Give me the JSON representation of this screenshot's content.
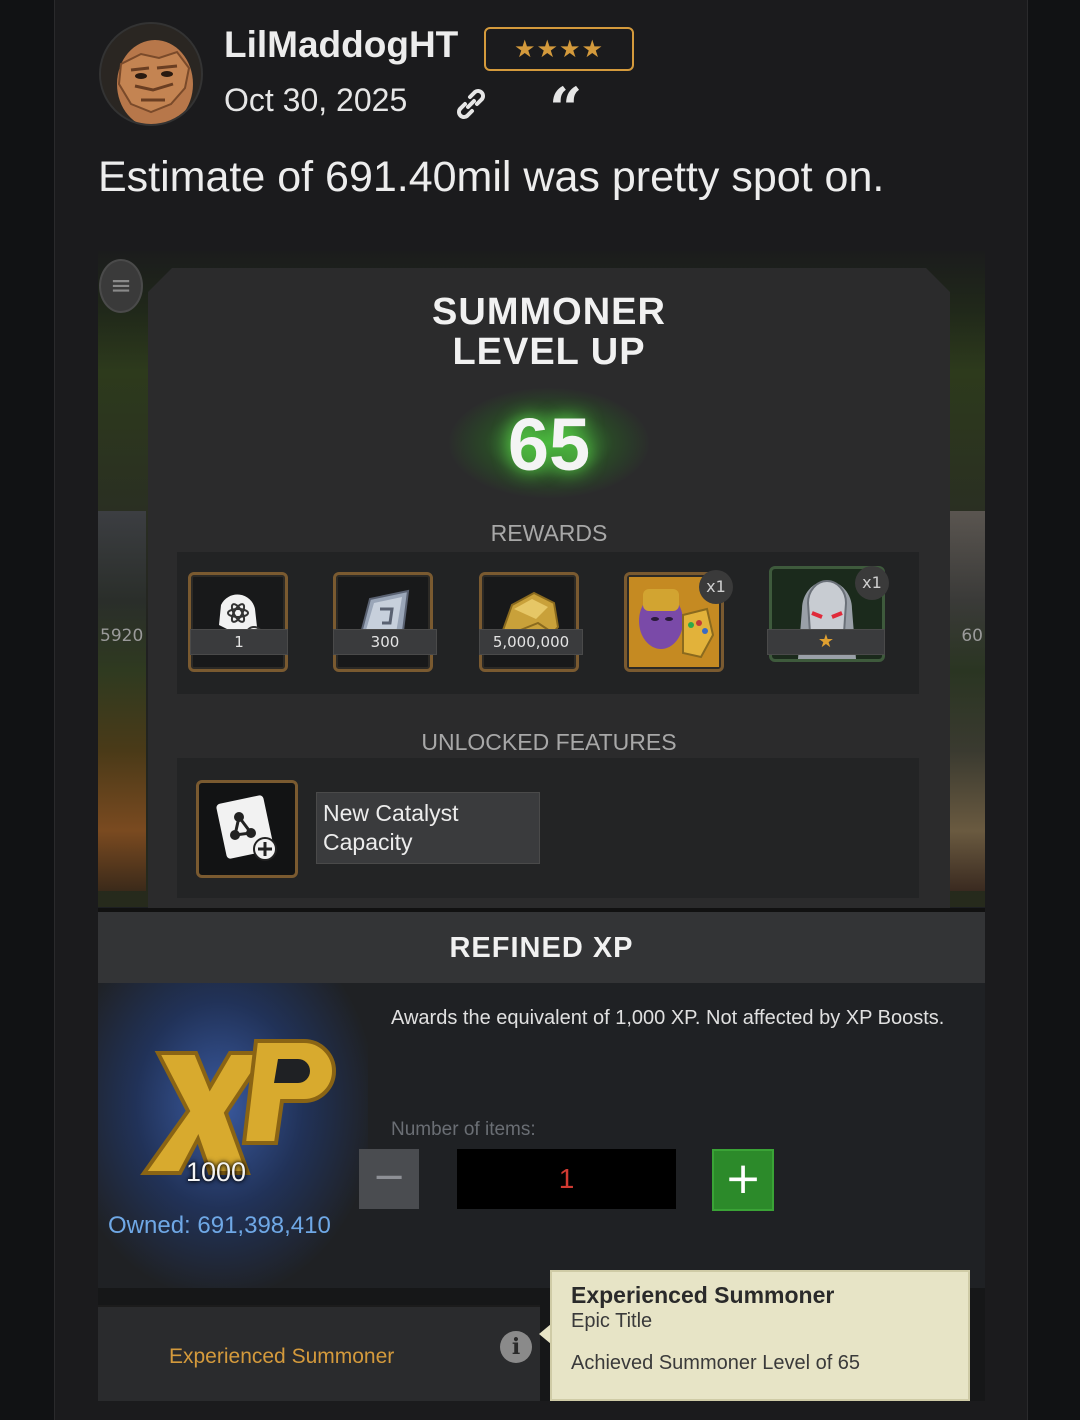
{
  "post": {
    "username": "LilMaddogHT",
    "rank_badge": "★★★★",
    "date": "Oct 30, 2025",
    "body": "Estimate of 691.40mil was pretty spot on."
  },
  "game": {
    "left_side_numbers": "5920",
    "right_side_numbers": "60",
    "level_up": {
      "title_line1": "SUMMONER",
      "title_line2": "LEVEL UP",
      "level": "65",
      "rewards_label": "REWARDS",
      "rewards": [
        {
          "icon": "catalyst-head-icon",
          "qty": "1"
        },
        {
          "icon": "tile-shard-icon",
          "qty": "300"
        },
        {
          "icon": "gold-nugget-icon",
          "qty": "5,000,000"
        },
        {
          "icon": "thanos-avatar-icon",
          "badge": "x1"
        },
        {
          "icon": "ultron-portrait-icon",
          "badge": "x1",
          "qty": "★"
        }
      ],
      "features_label": "UNLOCKED FEATURES",
      "feature": "New Catalyst Capacity"
    },
    "refined_xp": {
      "title": "REFINED XP",
      "description": "Awards the equivalent of 1,000 XP. Not affected by XP Boosts.",
      "art_count": "1000",
      "owned": "Owned: 691,398,410",
      "items_label": "Number of items:",
      "minus": "−",
      "quantity": "1",
      "plus": "+"
    },
    "title_card": {
      "name": "Experienced Summoner",
      "info": "i"
    },
    "tooltip": {
      "title": "Experienced Summoner",
      "subtitle": "Epic Title",
      "description": "Achieved Summoner Level of 65"
    }
  },
  "colors": {
    "accent_gold": "#d49a3c",
    "level_glow": "#5ee04a",
    "owned_blue": "#6fa8e6",
    "plus_green": "#2c8a2a"
  }
}
